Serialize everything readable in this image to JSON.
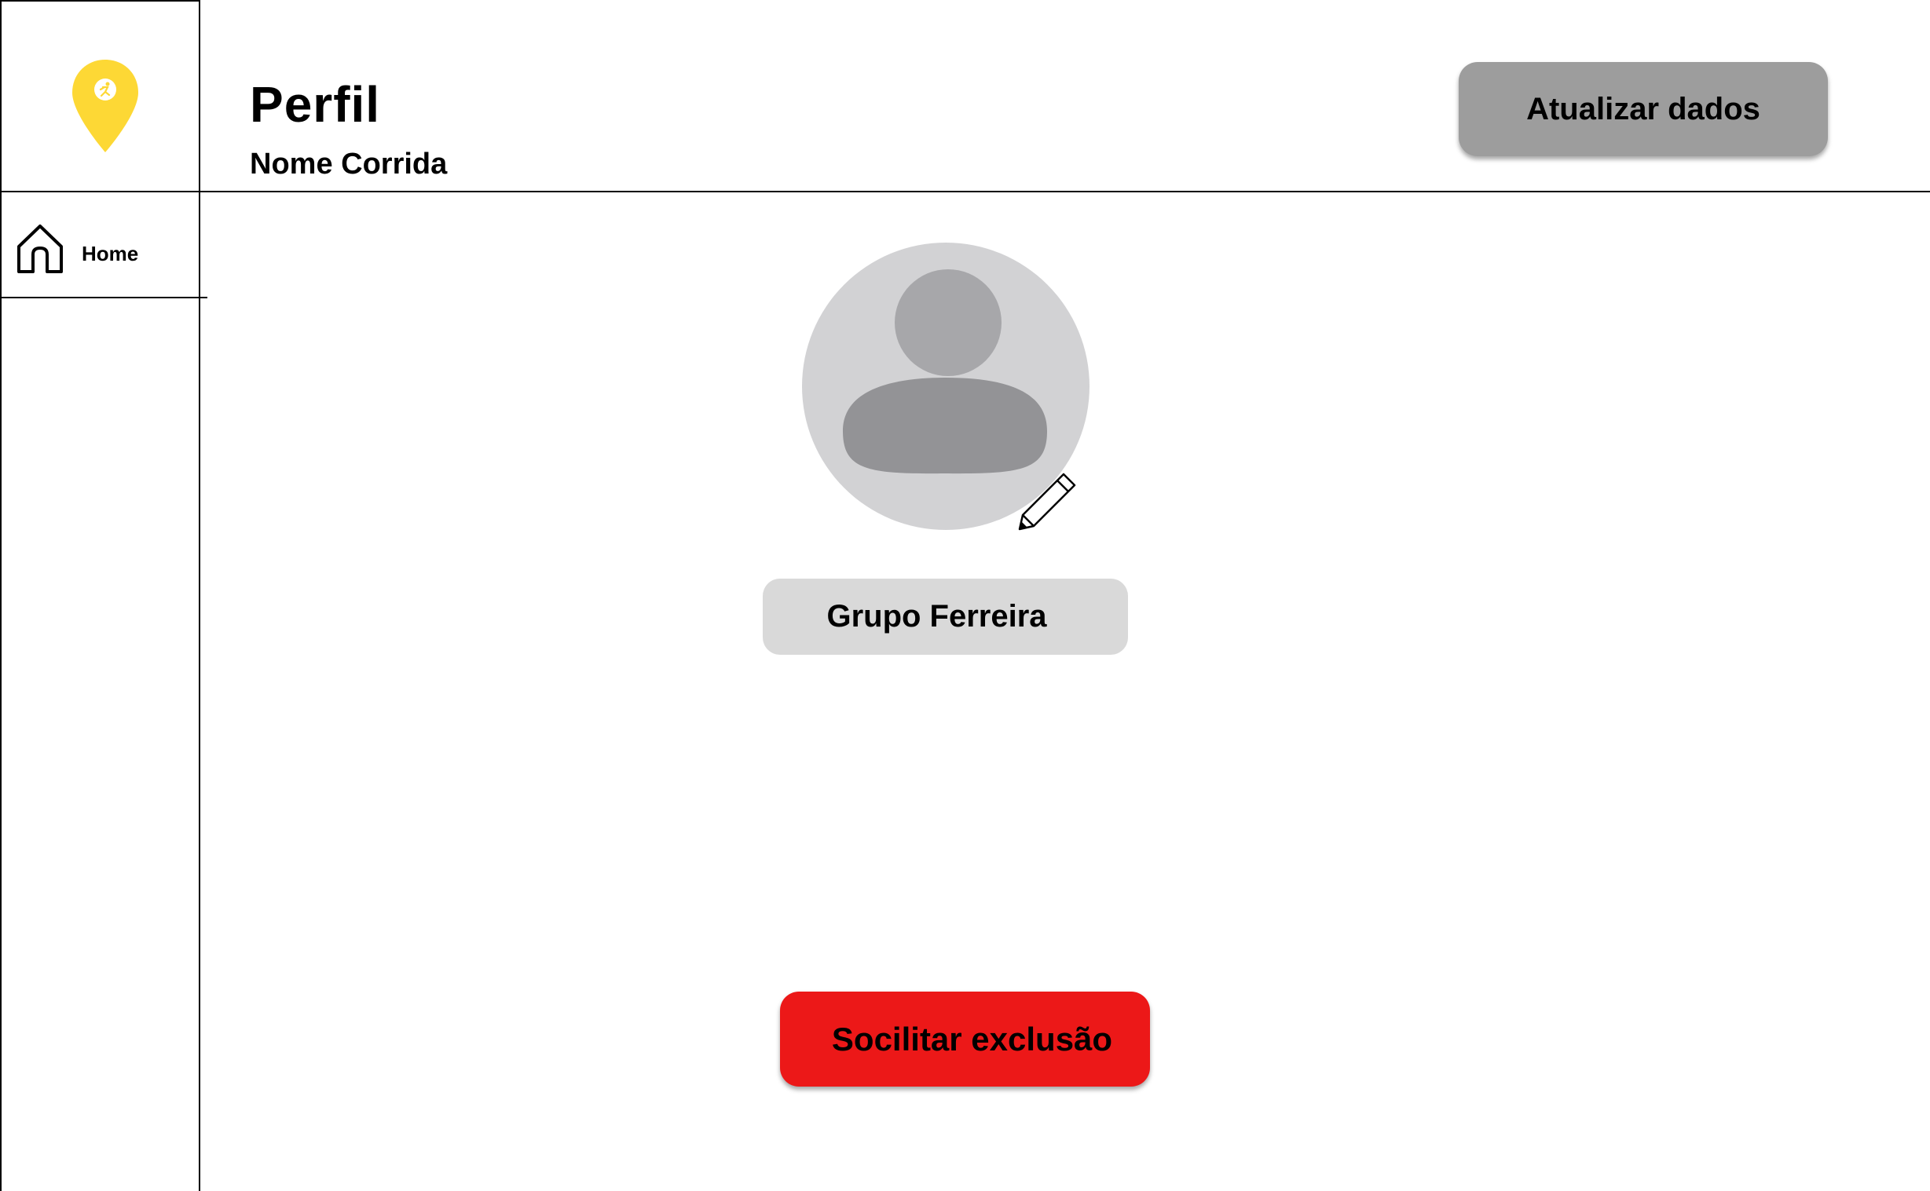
{
  "sidebar": {
    "logo_icon": "location-pin-runner-icon",
    "logo_color": "#fdd835",
    "items": [
      {
        "icon": "home-icon",
        "label": "Home"
      }
    ]
  },
  "header": {
    "title": "Perfil",
    "subtitle": "Nome Corrida",
    "update_button_label": "Atualizar dados"
  },
  "profile": {
    "avatar_icon": "user-avatar-icon",
    "edit_icon": "pencil-icon",
    "name": "Grupo Ferreira"
  },
  "actions": {
    "delete_button_label": "Socilitar exclusão",
    "delete_button_color": "#ec1818"
  }
}
